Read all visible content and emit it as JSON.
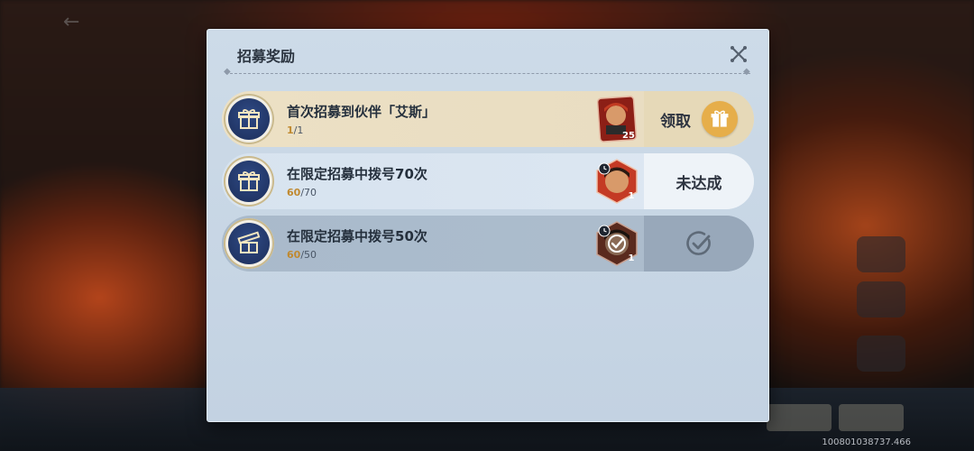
{
  "dialog": {
    "title": "招募奖励",
    "close_icon": "close-icon"
  },
  "rows": [
    {
      "title": "首次招募到伙伴「艾斯」",
      "progress_current": "1",
      "progress_total": "/1",
      "avatar_level": "25",
      "status": "claimable",
      "action_label": "领取"
    },
    {
      "title": "在限定招募中拨号70次",
      "progress_current": "60",
      "progress_total": "/70",
      "avatar_level": "1",
      "status": "not-achieved",
      "action_label": "未达成"
    },
    {
      "title": "在限定招募中拨号50次",
      "progress_current": "60",
      "progress_total": "/50",
      "avatar_level": "1",
      "status": "claimed",
      "action_label": ""
    }
  ],
  "footer": {
    "version": "100801038737.466"
  },
  "colors": {
    "accent_gold": "#c0892f",
    "claim_button": "#e6ae4a",
    "badge_navy": "#1c2e5a"
  }
}
